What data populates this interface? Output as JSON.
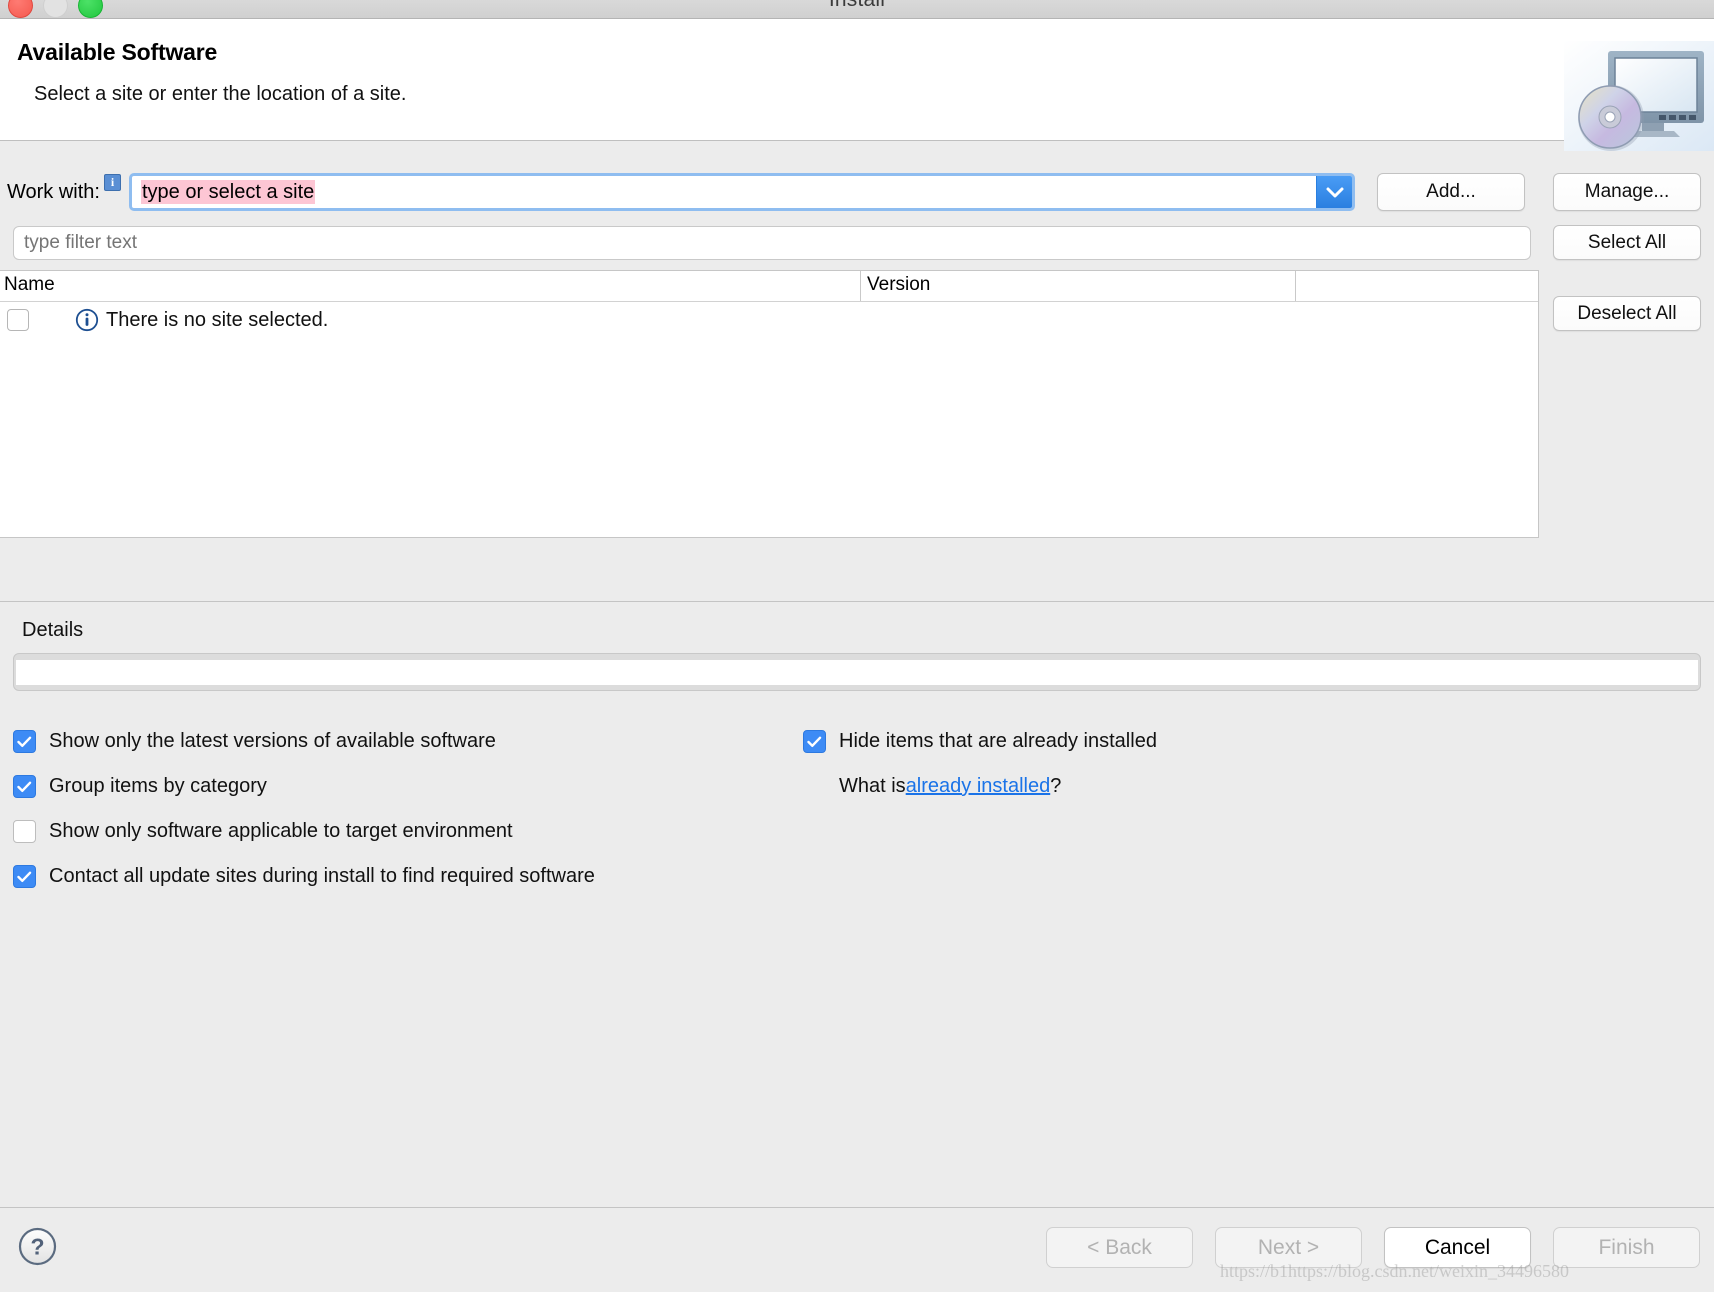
{
  "window": {
    "title": "Install",
    "traffic_lights": [
      "close",
      "minimize",
      "zoom"
    ]
  },
  "header": {
    "title": "Available Software",
    "subtitle": "Select a site or enter the location of a site.",
    "icon": "computer-cd-icon"
  },
  "work_with": {
    "label": "Work with:",
    "info_badge": "i",
    "combo_value": "type or select a site",
    "combo_selected": true,
    "dropdown_icon": "chevron-down-icon",
    "add_label": "Add...",
    "manage_label": "Manage..."
  },
  "filter": {
    "placeholder": "type filter text",
    "value": "",
    "select_all_label": "Select All",
    "deselect_all_label": "Deselect All"
  },
  "table": {
    "columns": [
      "Name",
      "Version",
      ""
    ],
    "rows": [
      {
        "checked": false,
        "icon": "info-circle-icon",
        "name": "There is no site selected.",
        "version": ""
      }
    ]
  },
  "details": {
    "label": "Details",
    "value": ""
  },
  "options": {
    "left": [
      {
        "label": "Show only the latest versions of available software",
        "checked": true
      },
      {
        "label": "Group items by category",
        "checked": true
      },
      {
        "label": "Show only software applicable to target environment",
        "checked": false
      },
      {
        "label": "Contact all update sites during install to find required software",
        "checked": true
      }
    ],
    "right": [
      {
        "label": "Hide items that are already installed",
        "checked": true
      }
    ],
    "whatis_prefix": "What is ",
    "whatis_link": "already installed",
    "whatis_suffix": "?"
  },
  "footer": {
    "help_icon": "question-mark-icon",
    "back_label": "< Back",
    "back_enabled": false,
    "next_label": "Next >",
    "next_enabled": false,
    "cancel_label": "Cancel",
    "cancel_enabled": true,
    "finish_label": "Finish",
    "finish_enabled": false,
    "watermark": "https://b1https://blog.csdn.net/weixin_34496580"
  },
  "colors": {
    "accent_blue": "#3d8bf5",
    "link_blue": "#1a73e8",
    "selection_pink": "#fdc6d4",
    "combo_focus": "#8fbdf0",
    "window_bg": "#ececec"
  }
}
